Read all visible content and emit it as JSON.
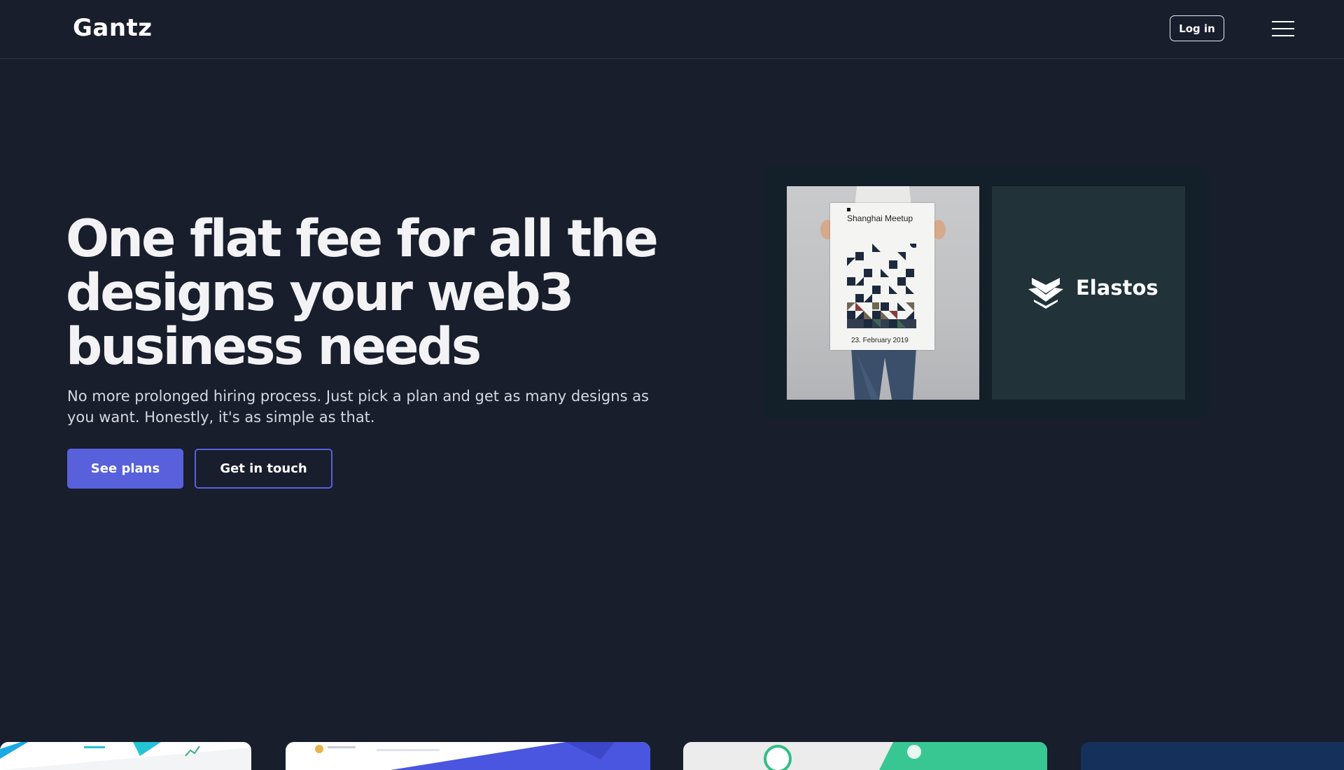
{
  "header": {
    "logo": "Gantz",
    "login_label": "Log in",
    "menu_icon": "hamburger-menu-icon"
  },
  "hero": {
    "headline": "One flat fee for all the designs your web3 business needs",
    "subtext": "No more prolonged hiring process. Just pick a plan and get as many designs as you want. Honestly, it's as simple as that.",
    "primary_cta": "See plans",
    "secondary_cta": "Get in touch"
  },
  "showcase": {
    "poster": {
      "title": "Shanghai Meetup",
      "date": "23. February 2019"
    },
    "brand": {
      "name": "Elastos",
      "icon": "elastos-logo-icon"
    }
  },
  "colors": {
    "background": "#181e2c",
    "accent": "#5960dc",
    "showcase_frame": "#131f29",
    "elastos_card": "#213239"
  }
}
